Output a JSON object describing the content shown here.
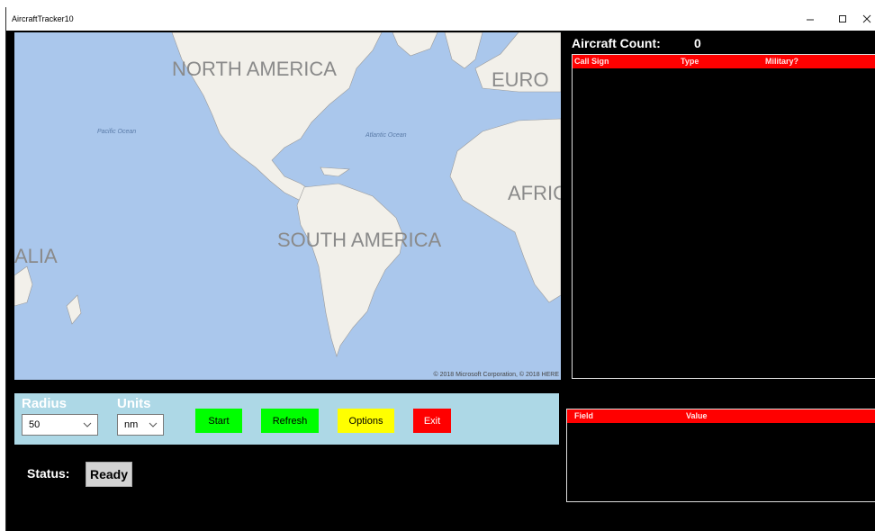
{
  "window": {
    "title": "AircraftTracker10",
    "minimize_glyph": "–",
    "maximize_glyph": "☐",
    "close_glyph": "✕"
  },
  "map": {
    "labels": {
      "north_america": "NORTH AMERICA",
      "south_america": "SOUTH AMERICA",
      "europe": "EURO",
      "africa": "AFRIC",
      "australia": "ALIA",
      "pacific": "Pacific Ocean",
      "atlantic": "Atlantic Ocean"
    },
    "attribution": "© 2018 Microsoft Corporation, © 2018 HERE",
    "colors": {
      "water": "#aac7ec",
      "land": "#f2f0ea",
      "border": "#9a9a9a"
    }
  },
  "controls": {
    "radius_label": "Radius",
    "radius_value": "50",
    "units_label": "Units",
    "units_value": "nm",
    "start_label": "Start",
    "refresh_label": "Refresh",
    "options_label": "Options",
    "exit_label": "Exit",
    "colors": {
      "panel": "#add8e6",
      "start": "#00ff00",
      "refresh": "#00ff00",
      "options": "#ffff00",
      "exit": "#ff0000"
    }
  },
  "status": {
    "label": "Status:",
    "value": "Ready"
  },
  "aircraft": {
    "count_label": "Aircraft Count:",
    "count_value": "0",
    "columns": [
      "Call Sign",
      "Type",
      "Military?"
    ]
  },
  "details": {
    "columns": [
      "Field",
      "Value"
    ]
  }
}
